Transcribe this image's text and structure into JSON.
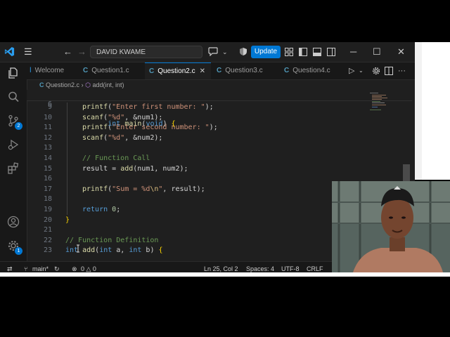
{
  "titlebar": {
    "search_text": "DAVID KWAME",
    "update_label": "Update"
  },
  "activity": {
    "source_control_badge": "2",
    "settings_badge": "1"
  },
  "tabs": [
    {
      "label": "Welcome",
      "has_c_icon": false
    },
    {
      "label": "Question1.c",
      "has_c_icon": true
    },
    {
      "label": "Question2.c",
      "has_c_icon": true,
      "active": true
    },
    {
      "label": "Question3.c",
      "has_c_icon": true
    },
    {
      "label": "Question4.c",
      "has_c_icon": true
    }
  ],
  "breadcrumb": {
    "file": "Question2.c",
    "symbol": "add(int, int)"
  },
  "editor": {
    "sticky_line": {
      "num": "6",
      "text": "int main(void) {"
    },
    "lines": [
      {
        "num": "9",
        "indent": 1,
        "parts": [
          [
            "fn",
            "printf"
          ],
          [
            "pl",
            "("
          ],
          [
            "str",
            "\"Enter first number: \""
          ],
          [
            "pl",
            ");"
          ]
        ]
      },
      {
        "num": "10",
        "indent": 1,
        "parts": [
          [
            "fn",
            "scanf"
          ],
          [
            "pl",
            "("
          ],
          [
            "str",
            "\"%d\""
          ],
          [
            "pl",
            ", &num1);"
          ]
        ]
      },
      {
        "num": "11",
        "indent": 1,
        "parts": [
          [
            "fn",
            "printf"
          ],
          [
            "pl",
            "("
          ],
          [
            "str",
            "\"Enter second number: \""
          ],
          [
            "pl",
            ");"
          ]
        ]
      },
      {
        "num": "12",
        "indent": 1,
        "parts": [
          [
            "fn",
            "scanf"
          ],
          [
            "pl",
            "("
          ],
          [
            "str",
            "\"%d\""
          ],
          [
            "pl",
            ", &num2);"
          ]
        ]
      },
      {
        "num": "13",
        "indent": 0,
        "parts": []
      },
      {
        "num": "14",
        "indent": 1,
        "parts": [
          [
            "cm",
            "// Function Call"
          ]
        ]
      },
      {
        "num": "15",
        "indent": 1,
        "parts": [
          [
            "pl",
            "result = "
          ],
          [
            "fn",
            "add"
          ],
          [
            "pl",
            "(num1, num2);"
          ]
        ]
      },
      {
        "num": "16",
        "indent": 0,
        "parts": []
      },
      {
        "num": "17",
        "indent": 1,
        "parts": [
          [
            "fn",
            "printf"
          ],
          [
            "pl",
            "("
          ],
          [
            "str",
            "\"Sum = %d"
          ],
          [
            "esc",
            "\\n"
          ],
          [
            "str",
            "\""
          ],
          [
            "pl",
            ", result);"
          ]
        ]
      },
      {
        "num": "18",
        "indent": 0,
        "parts": []
      },
      {
        "num": "19",
        "indent": 1,
        "parts": [
          [
            "kw",
            "return"
          ],
          [
            "pl",
            " "
          ],
          [
            "num",
            "0"
          ],
          [
            "pl",
            ";"
          ]
        ]
      },
      {
        "num": "20",
        "indent": 0,
        "parts": [
          [
            "br",
            "}"
          ]
        ]
      },
      {
        "num": "21",
        "indent": 0,
        "parts": []
      },
      {
        "num": "22",
        "indent": 0,
        "parts": [
          [
            "cm",
            "// Function Definition"
          ]
        ]
      },
      {
        "num": "23",
        "indent": 0,
        "parts": [
          [
            "kw",
            "int"
          ],
          [
            "pl",
            " "
          ],
          [
            "fn",
            "add"
          ],
          [
            "pl",
            "("
          ],
          [
            "kw",
            "int"
          ],
          [
            "pl",
            " a, "
          ],
          [
            "kw",
            "int"
          ],
          [
            "pl",
            " b) "
          ],
          [
            "br",
            "{"
          ]
        ]
      }
    ]
  },
  "status": {
    "branch": "main*",
    "problems": "0 △ 0",
    "position": "Ln 25, Col 2",
    "spaces": "Spaces: 4",
    "encoding": "UTF-8",
    "eol": "CRLF"
  },
  "colors": {
    "accent": "#0078d4",
    "background": "#1f1f1f",
    "keyword": "#569cd6",
    "function": "#dcdcaa",
    "string": "#ce9178",
    "comment": "#6a9955"
  }
}
